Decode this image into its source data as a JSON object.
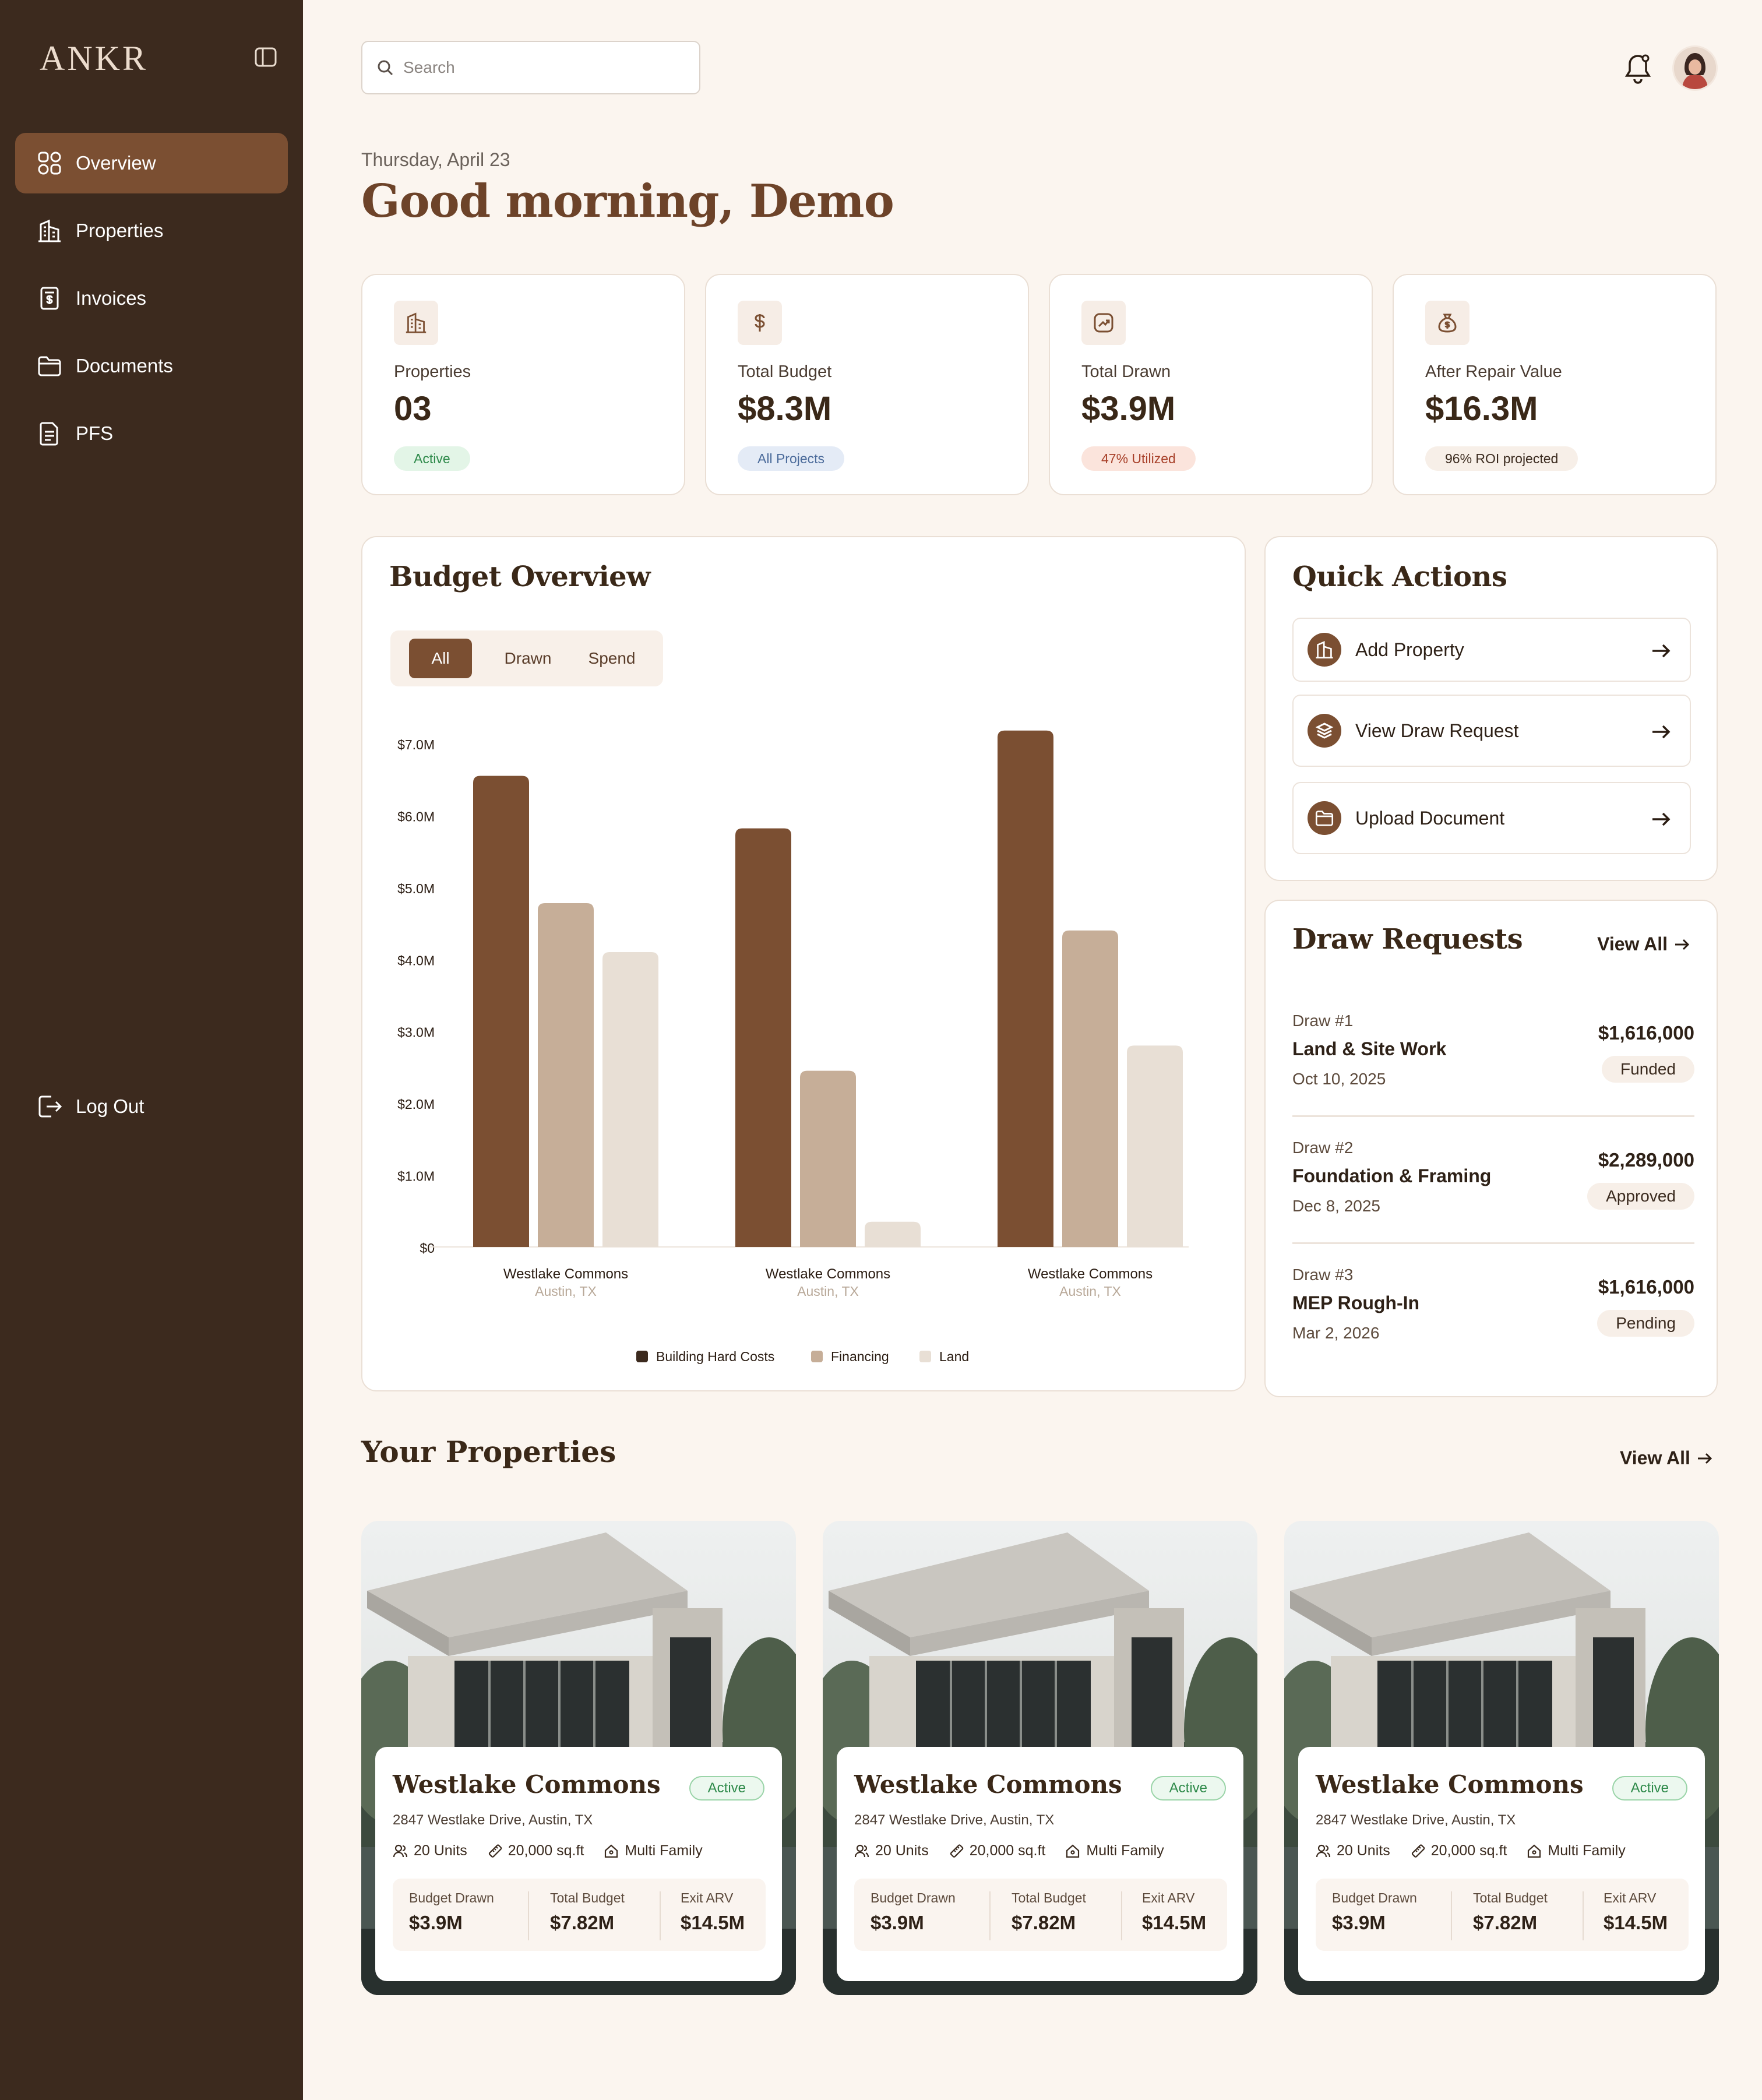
{
  "app": {
    "logo": "ANKR"
  },
  "sidebar": {
    "items": [
      {
        "label": "Overview",
        "icon": "grid-icon",
        "active": true
      },
      {
        "label": "Properties",
        "icon": "building-icon"
      },
      {
        "label": "Invoices",
        "icon": "invoice-icon"
      },
      {
        "label": "Documents",
        "icon": "folder-icon"
      },
      {
        "label": "PFS",
        "icon": "file-icon"
      }
    ],
    "logout_label": "Log Out"
  },
  "header": {
    "search_placeholder": "Search",
    "date": "Thursday, April 23",
    "greeting": "Good morning, Demo"
  },
  "stats": [
    {
      "label": "Properties",
      "value": "03",
      "badge": "Active",
      "badge_bg": "#e3f5e7",
      "badge_fg": "#2e8a4a",
      "icon": "building-icon"
    },
    {
      "label": "Total Budget",
      "value": "$8.3M",
      "badge": "All Projects",
      "badge_bg": "#e4ebf6",
      "badge_fg": "#4a6a9a",
      "icon": "dollar-icon"
    },
    {
      "label": "Total Drawn",
      "value": "$3.9M",
      "badge": "47% Utilized",
      "badge_bg": "#fbe4dc",
      "badge_fg": "#a8412a",
      "icon": "trend-icon"
    },
    {
      "label": "After Repair Value",
      "value": "$16.3M",
      "badge": "96% ROI projected",
      "badge_bg": "#f7efe8",
      "badge_fg": "#3a2a1e",
      "icon": "money-bag-icon"
    }
  ],
  "budget": {
    "title": "Budget Overview",
    "tabs": [
      "All",
      "Drawn",
      "Spend"
    ]
  },
  "chart_data": {
    "type": "bar",
    "categories": [
      "Westlake Commons",
      "Westlake Commons",
      "Westlake Commons"
    ],
    "category_sublabels": [
      "Austin, TX",
      "Austin, TX",
      "Austin, TX"
    ],
    "series": [
      {
        "name": "Building Hard Costs",
        "color": "#7b4f32",
        "values": [
          6.55,
          5.82,
          7.18
        ]
      },
      {
        "name": "Financing",
        "color": "#c6ae98",
        "values": [
          4.78,
          2.45,
          4.4
        ]
      },
      {
        "name": "Land",
        "color": "#e8dfd5",
        "values": [
          4.1,
          0.35,
          2.8
        ]
      }
    ],
    "yticks": [
      "$7.0M",
      "$6.0M",
      "$5.0M",
      "$4.0M",
      "$3.0M",
      "$2.0M",
      "$1.0M",
      "$0"
    ],
    "ylim": [
      0,
      7
    ],
    "legend": "bottom",
    "grid": false
  },
  "quick_actions": {
    "title": "Quick Actions",
    "items": [
      {
        "label": "Add Property",
        "icon": "building-icon"
      },
      {
        "label": "View Draw Request",
        "icon": "layers-icon"
      },
      {
        "label": "Upload Document",
        "icon": "folder-icon"
      }
    ]
  },
  "draw_requests": {
    "title": "Draw Requests",
    "view_all": "View All",
    "items": [
      {
        "num": "Draw #1",
        "name": "Land & Site Work",
        "date": "Oct 10, 2025",
        "amount": "$1,616,000",
        "status": "Funded"
      },
      {
        "num": "Draw #2",
        "name": "Foundation & Framing",
        "date": "Dec 8, 2025",
        "amount": "$2,289,000",
        "status": "Approved"
      },
      {
        "num": "Draw #3",
        "name": "MEP Rough-In",
        "date": "Mar 2, 2026",
        "amount": "$1,616,000",
        "status": "Pending"
      }
    ]
  },
  "properties": {
    "title": "Your Properties",
    "view_all": "View All",
    "items": [
      {
        "name": "Westlake Commons",
        "status": "Active",
        "address": "2847 Westlake Drive, Austin, TX",
        "units": "20 Units",
        "sqft": "20,000 sq.ft",
        "type": "Multi Family",
        "budget_drawn_label": "Budget Drawn",
        "budget_drawn": "$3.9M",
        "total_budget_label": "Total Budget",
        "total_budget": "$7.82M",
        "exit_arv_label": "Exit ARV",
        "exit_arv": "$14.5M"
      },
      {
        "name": "Westlake Commons",
        "status": "Active",
        "address": "2847 Westlake Drive, Austin, TX",
        "units": "20 Units",
        "sqft": "20,000 sq.ft",
        "type": "Multi Family",
        "budget_drawn_label": "Budget Drawn",
        "budget_drawn": "$3.9M",
        "total_budget_label": "Total Budget",
        "total_budget": "$7.82M",
        "exit_arv_label": "Exit ARV",
        "exit_arv": "$14.5M"
      },
      {
        "name": "Westlake Commons",
        "status": "Active",
        "address": "2847 Westlake Drive, Austin, TX",
        "units": "20 Units",
        "sqft": "20,000 sq.ft",
        "type": "Multi Family",
        "budget_drawn_label": "Budget Drawn",
        "budget_drawn": "$3.9M",
        "total_budget_label": "Total Budget",
        "total_budget": "$7.82M",
        "exit_arv_label": "Exit ARV",
        "exit_arv": "$14.5M"
      }
    ]
  }
}
